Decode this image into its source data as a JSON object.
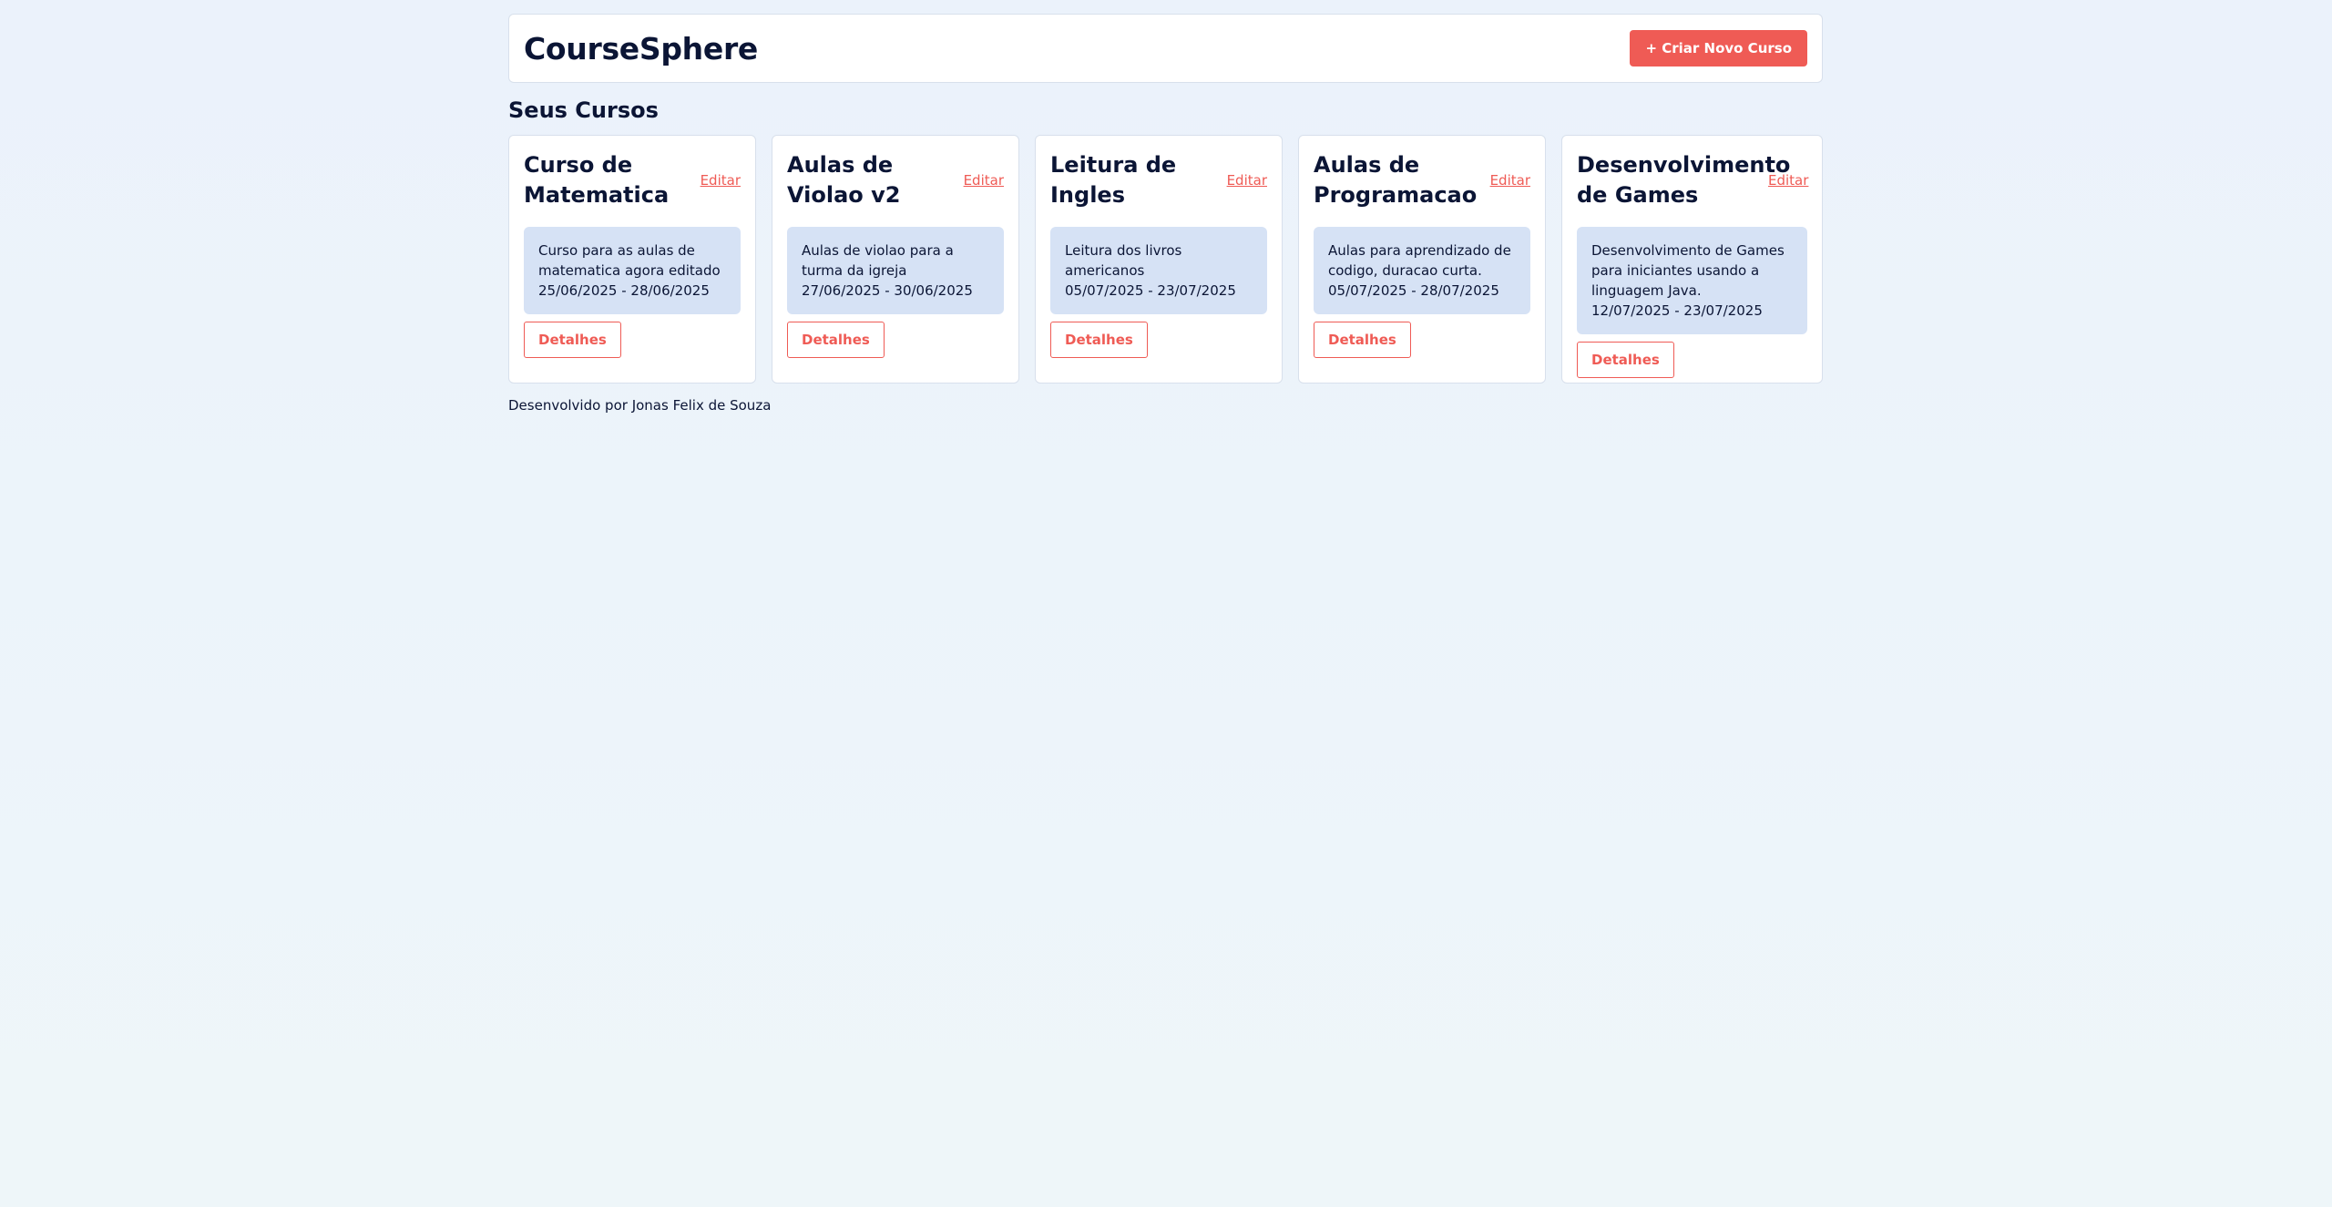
{
  "header": {
    "brand": "CourseSphere",
    "create_button": "+ Criar Novo Curso"
  },
  "section": {
    "title": "Seus Cursos"
  },
  "courses": [
    {
      "title": "Curso de Matematica",
      "edit": "Editar",
      "description": "Curso para as aulas de matematica agora editado",
      "dates": "25/06/2025 - 28/06/2025",
      "details": "Detalhes"
    },
    {
      "title": "Aulas de Violao v2",
      "edit": "Editar",
      "description": "Aulas de violao para a turma da igreja",
      "dates": "27/06/2025 - 30/06/2025",
      "details": "Detalhes"
    },
    {
      "title": "Leitura de Ingles",
      "edit": "Editar",
      "description": "Leitura dos livros americanos",
      "dates": "05/07/2025 - 23/07/2025",
      "details": "Detalhes"
    },
    {
      "title": "Aulas de Programacao",
      "edit": "Editar",
      "description": "Aulas para aprendizado de codigo, duracao curta.",
      "dates": "05/07/2025 - 28/07/2025",
      "details": "Detalhes"
    },
    {
      "title": "Desenvolvimento de Games",
      "edit": "Editar",
      "description": "Desenvolvimento de Games para iniciantes usando a linguagem Java.",
      "dates": "12/07/2025 - 23/07/2025",
      "details": "Detalhes"
    }
  ],
  "footer": {
    "text": "Desenvolvido por Jonas Felix de Souza"
  },
  "colors": {
    "accent": "#ef5b55",
    "text": "#0b1535",
    "description_bg": "#d6e2f5",
    "page_bg": "#ebf2fb"
  }
}
